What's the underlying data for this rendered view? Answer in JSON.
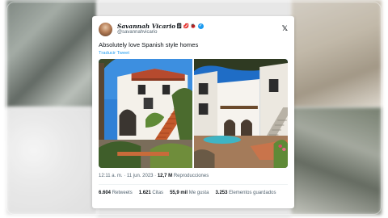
{
  "tweet": {
    "author": {
      "display_name": "Savannah Vicario",
      "emojis": [
        "🗒",
        "💋",
        "🐞"
      ],
      "handle": "@savannahvicario",
      "verified": true
    },
    "brand_icon": "x-logo-icon",
    "text": "Absolutely love Spanish style homes",
    "translate_link": "Traducir Tweet",
    "timestamp": "12:11 a. m. · 11 jun. 2023 ·",
    "views_count": "12,7 M",
    "views_label": "Reproducciones",
    "stats": [
      {
        "value": "6.604",
        "label": "Retweets"
      },
      {
        "value": "1.621",
        "label": "Citas"
      },
      {
        "value": "55,9 mil",
        "label": "Me gusta"
      },
      {
        "value": "3.253",
        "label": "Elementos guardados"
      }
    ]
  },
  "colors": {
    "accent": "#1d9bf0",
    "text_primary": "#0f1419",
    "text_secondary": "#536471"
  }
}
